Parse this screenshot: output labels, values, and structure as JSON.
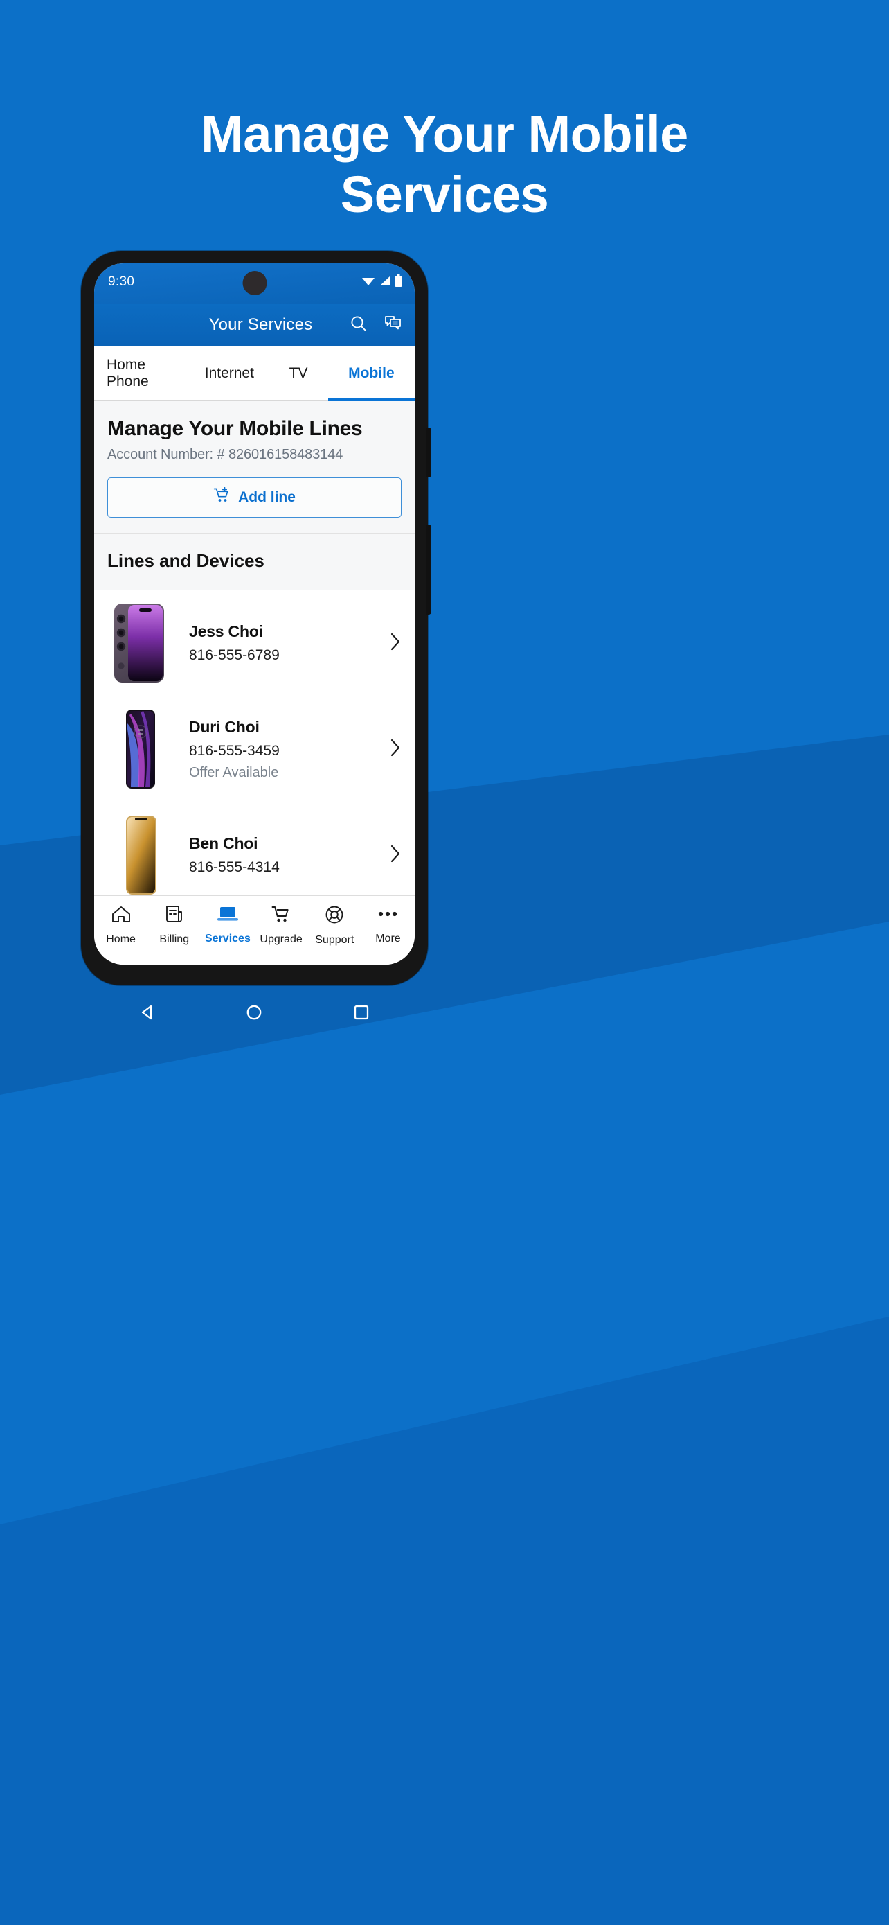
{
  "hero": {
    "headline_line1": "Manage Your Mobile",
    "headline_line2": "Services",
    "bg_color": "#0C70C8",
    "text_color": "#FFFFFF"
  },
  "status_bar": {
    "time": "9:30",
    "icons": [
      "wifi-icon",
      "cellular-signal-icon",
      "battery-icon"
    ]
  },
  "app_bar": {
    "title": "Your Services",
    "actions": [
      {
        "name": "search-icon",
        "label": "Search"
      },
      {
        "name": "chat-icon",
        "label": "Messages"
      }
    ]
  },
  "tabs": {
    "active_color": "#0A74D6",
    "items": [
      {
        "label": "Home Phone",
        "active": false
      },
      {
        "label": "Internet",
        "active": false
      },
      {
        "label": "TV",
        "active": false
      },
      {
        "label": "Mobile",
        "active": true
      }
    ]
  },
  "manage": {
    "title": "Manage Your Mobile Lines",
    "account_label": "Account Number: # 826016158483144",
    "add_line_label": "Add line",
    "add_line_icon": "cart-plus-icon",
    "accent_color": "#0A6FCE"
  },
  "lines_section": {
    "header": "Lines and Devices",
    "rows": [
      {
        "name": "Jess Choi",
        "phone": "816-555-6789",
        "offer": "",
        "device_icon": "iphone-deep-purple-icon"
      },
      {
        "name": "Duri Choi",
        "phone": "816-555-3459",
        "offer": "Offer Available",
        "device_icon": "android-purple-wave-icon"
      },
      {
        "name": "Ben Choi",
        "phone": "816-555-4314",
        "offer": "",
        "device_icon": "iphone-gold-icon"
      }
    ],
    "chevron_icon": "chevron-right-icon"
  },
  "bottom_nav": {
    "active_color": "#0A74D6",
    "items": [
      {
        "label": "Home",
        "icon": "house-icon",
        "active": false
      },
      {
        "label": "Billing",
        "icon": "bill-document-icon",
        "active": false
      },
      {
        "label": "Services",
        "icon": "laptop-icon",
        "active": true
      },
      {
        "label": "Upgrade",
        "icon": "shopping-cart-icon",
        "active": false
      },
      {
        "label": "Support",
        "icon": "life-ring-icon",
        "active": false
      },
      {
        "label": "More",
        "icon": "ellipsis-icon",
        "active": false
      }
    ]
  },
  "system_nav": {
    "items": [
      {
        "name": "back-icon"
      },
      {
        "name": "home-circle-icon"
      },
      {
        "name": "recents-square-icon"
      }
    ]
  }
}
